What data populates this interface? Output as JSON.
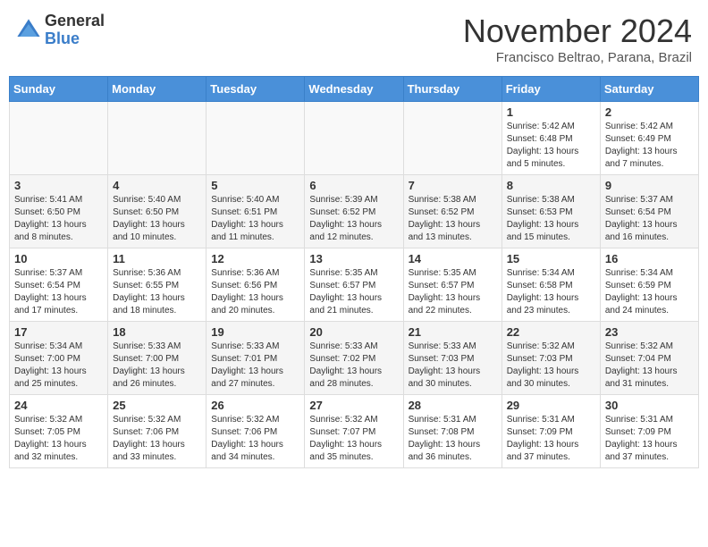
{
  "header": {
    "logo_general": "General",
    "logo_blue": "Blue",
    "month_title": "November 2024",
    "subtitle": "Francisco Beltrao, Parana, Brazil"
  },
  "weekdays": [
    "Sunday",
    "Monday",
    "Tuesday",
    "Wednesday",
    "Thursday",
    "Friday",
    "Saturday"
  ],
  "weeks": [
    [
      {
        "day": "",
        "info": ""
      },
      {
        "day": "",
        "info": ""
      },
      {
        "day": "",
        "info": ""
      },
      {
        "day": "",
        "info": ""
      },
      {
        "day": "",
        "info": ""
      },
      {
        "day": "1",
        "info": "Sunrise: 5:42 AM\nSunset: 6:48 PM\nDaylight: 13 hours and 5 minutes."
      },
      {
        "day": "2",
        "info": "Sunrise: 5:42 AM\nSunset: 6:49 PM\nDaylight: 13 hours and 7 minutes."
      }
    ],
    [
      {
        "day": "3",
        "info": "Sunrise: 5:41 AM\nSunset: 6:50 PM\nDaylight: 13 hours and 8 minutes."
      },
      {
        "day": "4",
        "info": "Sunrise: 5:40 AM\nSunset: 6:50 PM\nDaylight: 13 hours and 10 minutes."
      },
      {
        "day": "5",
        "info": "Sunrise: 5:40 AM\nSunset: 6:51 PM\nDaylight: 13 hours and 11 minutes."
      },
      {
        "day": "6",
        "info": "Sunrise: 5:39 AM\nSunset: 6:52 PM\nDaylight: 13 hours and 12 minutes."
      },
      {
        "day": "7",
        "info": "Sunrise: 5:38 AM\nSunset: 6:52 PM\nDaylight: 13 hours and 13 minutes."
      },
      {
        "day": "8",
        "info": "Sunrise: 5:38 AM\nSunset: 6:53 PM\nDaylight: 13 hours and 15 minutes."
      },
      {
        "day": "9",
        "info": "Sunrise: 5:37 AM\nSunset: 6:54 PM\nDaylight: 13 hours and 16 minutes."
      }
    ],
    [
      {
        "day": "10",
        "info": "Sunrise: 5:37 AM\nSunset: 6:54 PM\nDaylight: 13 hours and 17 minutes."
      },
      {
        "day": "11",
        "info": "Sunrise: 5:36 AM\nSunset: 6:55 PM\nDaylight: 13 hours and 18 minutes."
      },
      {
        "day": "12",
        "info": "Sunrise: 5:36 AM\nSunset: 6:56 PM\nDaylight: 13 hours and 20 minutes."
      },
      {
        "day": "13",
        "info": "Sunrise: 5:35 AM\nSunset: 6:57 PM\nDaylight: 13 hours and 21 minutes."
      },
      {
        "day": "14",
        "info": "Sunrise: 5:35 AM\nSunset: 6:57 PM\nDaylight: 13 hours and 22 minutes."
      },
      {
        "day": "15",
        "info": "Sunrise: 5:34 AM\nSunset: 6:58 PM\nDaylight: 13 hours and 23 minutes."
      },
      {
        "day": "16",
        "info": "Sunrise: 5:34 AM\nSunset: 6:59 PM\nDaylight: 13 hours and 24 minutes."
      }
    ],
    [
      {
        "day": "17",
        "info": "Sunrise: 5:34 AM\nSunset: 7:00 PM\nDaylight: 13 hours and 25 minutes."
      },
      {
        "day": "18",
        "info": "Sunrise: 5:33 AM\nSunset: 7:00 PM\nDaylight: 13 hours and 26 minutes."
      },
      {
        "day": "19",
        "info": "Sunrise: 5:33 AM\nSunset: 7:01 PM\nDaylight: 13 hours and 27 minutes."
      },
      {
        "day": "20",
        "info": "Sunrise: 5:33 AM\nSunset: 7:02 PM\nDaylight: 13 hours and 28 minutes."
      },
      {
        "day": "21",
        "info": "Sunrise: 5:33 AM\nSunset: 7:03 PM\nDaylight: 13 hours and 30 minutes."
      },
      {
        "day": "22",
        "info": "Sunrise: 5:32 AM\nSunset: 7:03 PM\nDaylight: 13 hours and 30 minutes."
      },
      {
        "day": "23",
        "info": "Sunrise: 5:32 AM\nSunset: 7:04 PM\nDaylight: 13 hours and 31 minutes."
      }
    ],
    [
      {
        "day": "24",
        "info": "Sunrise: 5:32 AM\nSunset: 7:05 PM\nDaylight: 13 hours and 32 minutes."
      },
      {
        "day": "25",
        "info": "Sunrise: 5:32 AM\nSunset: 7:06 PM\nDaylight: 13 hours and 33 minutes."
      },
      {
        "day": "26",
        "info": "Sunrise: 5:32 AM\nSunset: 7:06 PM\nDaylight: 13 hours and 34 minutes."
      },
      {
        "day": "27",
        "info": "Sunrise: 5:32 AM\nSunset: 7:07 PM\nDaylight: 13 hours and 35 minutes."
      },
      {
        "day": "28",
        "info": "Sunrise: 5:31 AM\nSunset: 7:08 PM\nDaylight: 13 hours and 36 minutes."
      },
      {
        "day": "29",
        "info": "Sunrise: 5:31 AM\nSunset: 7:09 PM\nDaylight: 13 hours and 37 minutes."
      },
      {
        "day": "30",
        "info": "Sunrise: 5:31 AM\nSunset: 7:09 PM\nDaylight: 13 hours and 37 minutes."
      }
    ]
  ]
}
